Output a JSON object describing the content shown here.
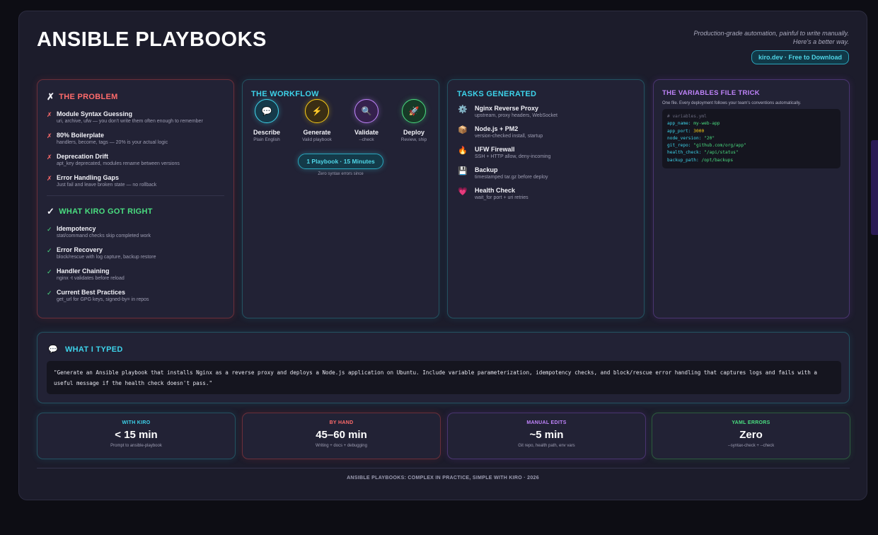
{
  "header": {
    "title": "ANSIBLE PLAYBOOKS",
    "tagline_line1": "Production-grade automation, painful to write manually.",
    "tagline_line2": "Here's a better way.",
    "badge": "kiro.dev · Free to Download"
  },
  "problem": {
    "heading": "THE PROBLEM",
    "heading_icon": "✗",
    "items": [
      {
        "mark": "✗",
        "title": "Module Syntax Guessing",
        "sub": "uri, archive, ufw — you don't write them often enough to remember"
      },
      {
        "mark": "✗",
        "title": "80% Boilerplate",
        "sub": "handlers, become, tags — 20% is your actual logic"
      },
      {
        "mark": "✗",
        "title": "Deprecation Drift",
        "sub": "apt_key deprecated, modules rename between versions"
      },
      {
        "mark": "✗",
        "title": "Error Handling Gaps",
        "sub": "Just fail and leave broken state — no rollback"
      }
    ]
  },
  "right": {
    "heading": "WHAT KIRO GOT RIGHT",
    "heading_icon": "✓",
    "items": [
      {
        "mark": "✓",
        "title": "Idempotency",
        "sub": "stat/command checks skip completed work"
      },
      {
        "mark": "✓",
        "title": "Error Recovery",
        "sub": "block/rescue with log capture, backup restore"
      },
      {
        "mark": "✓",
        "title": "Handler Chaining",
        "sub": "nginx -t validates before reload"
      },
      {
        "mark": "✓",
        "title": "Current Best Practices",
        "sub": "get_url for GPG keys, signed-by= in repos"
      }
    ]
  },
  "workflow": {
    "heading": "THE WORKFLOW",
    "steps": [
      {
        "icon": "💬",
        "title": "Describe",
        "sub": "Plain English"
      },
      {
        "icon": "⚡",
        "title": "Generate",
        "sub": "Valid playbook"
      },
      {
        "icon": "🔍",
        "title": "Validate",
        "sub": "--check"
      },
      {
        "icon": "🚀",
        "title": "Deploy",
        "sub": "Review, ship"
      }
    ],
    "pill": "1 Playbook · 15 Minutes",
    "note": "Zero syntax errors since"
  },
  "tasks": {
    "heading": "TASKS GENERATED",
    "items": [
      {
        "icon": "⚙️",
        "title": "Nginx Reverse Proxy",
        "sub": "upstream, proxy headers, WebSocket"
      },
      {
        "icon": "📦",
        "title": "Node.js + PM2",
        "sub": "version-checked install, startup"
      },
      {
        "icon": "🔥",
        "title": "UFW Firewall",
        "sub": "SSH + HTTP allow, deny-incoming"
      },
      {
        "icon": "💾",
        "title": "Backup",
        "sub": "timestamped tar.gz before deploy"
      },
      {
        "icon": "💗",
        "title": "Health Check",
        "sub": "wait_for port + uri retries"
      }
    ]
  },
  "variables": {
    "heading": "THE VARIABLES FILE TRICK",
    "desc": "One file. Every deployment follows your team's conventions automatically.",
    "comment": "# variables.yml",
    "lines": [
      {
        "key": "app_name:",
        "value": "my-web-app",
        "color": "#4ade80"
      },
      {
        "key": "app_port:",
        "value": "3000",
        "color": "#facc15"
      },
      {
        "key": "node_version:",
        "value": "\"20\"",
        "color": "#4ade80"
      },
      {
        "key": "git_repo:",
        "value": "\"github.com/org/app\"",
        "color": "#4ade80"
      },
      {
        "key": "health_check:",
        "value": "\"/api/status\"",
        "color": "#4ade80"
      },
      {
        "key": "backup_path:",
        "value": "/opt/backups",
        "color": "#4ade80"
      }
    ]
  },
  "typed": {
    "icon": "💬",
    "heading": "WHAT I TYPED",
    "prompt": "\"Generate an Ansible playbook that installs Nginx as a reverse proxy and deploys a Node.js application on Ubuntu. Include variable parameterization, idempotency checks, and block/rescue error handling that captures logs and fails with a useful message if the health check doesn't pass.\""
  },
  "stats": [
    {
      "label": "WITH KIRO",
      "value": "< 15 min",
      "sub": "Prompt to ansible-playbook",
      "color": "#3dd3ea"
    },
    {
      "label": "BY HAND",
      "value": "45–60 min",
      "sub": "Writing + docs + debugging",
      "color": "#ff6b6b"
    },
    {
      "label": "MANUAL EDITS",
      "value": "~5 min",
      "sub": "Git repo, health path, env vars",
      "color": "#c084fc"
    },
    {
      "label": "YAML ERRORS",
      "value": "Zero",
      "sub": "--syntax-check + --check",
      "color": "#4ade80"
    }
  ],
  "footer": "ANSIBLE PLAYBOOKS: COMPLEX IN PRACTICE, SIMPLE WITH KIRO · 2026",
  "colors": {
    "accent_cyan": "#3dd3ea",
    "accent_red": "#ff6b6b",
    "accent_purple": "#c084fc",
    "accent_green": "#4ade80",
    "background": "#1c1c2b"
  }
}
